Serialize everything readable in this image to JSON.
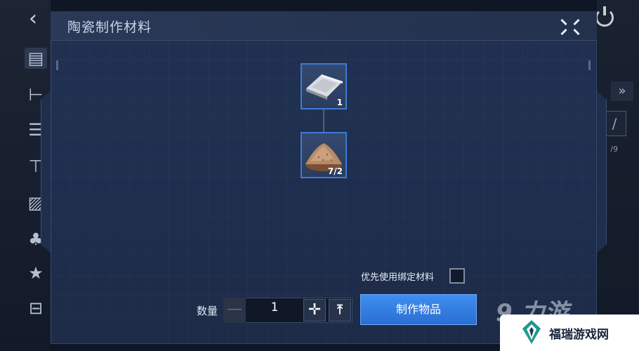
{
  "dialog": {
    "title": "陶瓷制作材料"
  },
  "recipe": {
    "output": {
      "name": "white-sheet",
      "count": "1"
    },
    "ingredient": {
      "name": "sand-pile",
      "count": "7/2"
    }
  },
  "controls": {
    "bind_label": "优先使用绑定材料",
    "bind_checked": false,
    "quantity_label": "数量",
    "quantity_value": "1",
    "minus_symbol": "—",
    "plus_symbol": "✛",
    "max_symbol": "⤒",
    "craft_label": "制作物品"
  },
  "background": {
    "right_count": "/9"
  },
  "watermark": {
    "logo_text": "9 力游",
    "site_name": "福瑞游戏网"
  },
  "colors": {
    "accent": "#3d7ad8",
    "craft_button": "#2b6ed2"
  }
}
